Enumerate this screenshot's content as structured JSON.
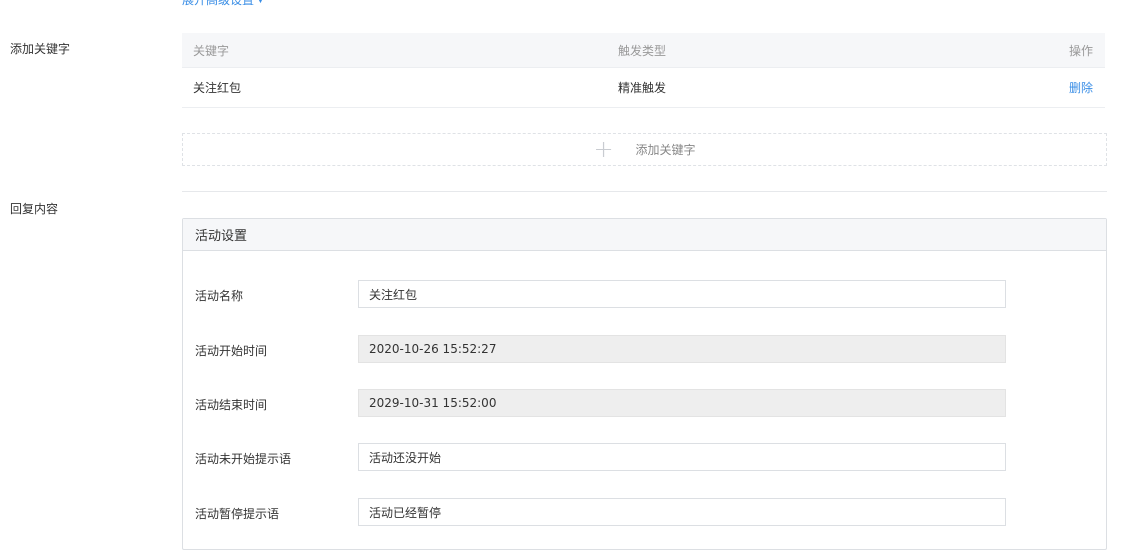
{
  "advanced_toggle": {
    "label": "展开高级设置"
  },
  "keywords": {
    "section_label": "添加关键字",
    "columns": [
      "关键字",
      "触发类型",
      "操作"
    ],
    "rows": [
      {
        "keyword": "关注红包",
        "trigger_type": "精准触发",
        "action": "删除"
      }
    ],
    "add_button": "添加关键字"
  },
  "reply": {
    "section_label": "回复内容",
    "panel_title": "活动设置",
    "fields": [
      {
        "label": "活动名称",
        "value": "关注红包",
        "disabled": false
      },
      {
        "label": "活动开始时间",
        "value": "2020-10-26 15:52:27",
        "disabled": true
      },
      {
        "label": "活动结束时间",
        "value": "2029-10-31 15:52:00",
        "disabled": true
      },
      {
        "label": "活动未开始提示语",
        "value": "活动还没开始",
        "disabled": false
      },
      {
        "label": "活动暂停提示语",
        "value": "活动已经暂停",
        "disabled": false
      }
    ]
  },
  "colors": {
    "link": "#3a8ee6",
    "header_bg": "#f6f7f9",
    "disabled_bg": "#eeeeee",
    "border": "#dcdfe3"
  }
}
